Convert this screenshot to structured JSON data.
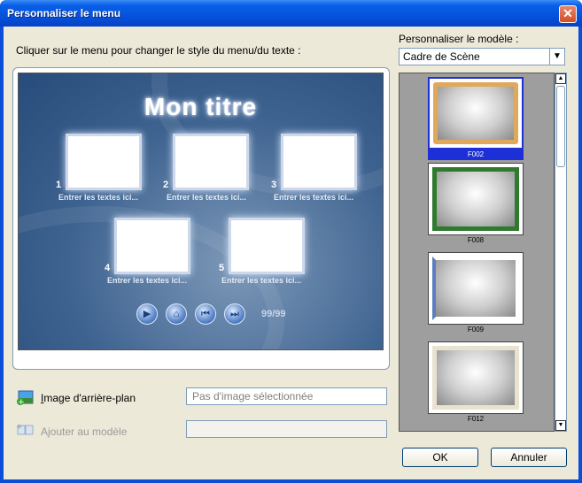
{
  "window": {
    "title": "Personnaliser le menu",
    "close_glyph": "✕"
  },
  "instructions": "Cliquer sur le menu pour changer le style du menu/du texte :",
  "preview": {
    "menu_title": "Mon titre",
    "items": [
      {
        "num": "1",
        "caption": "Entrer les textes ici..."
      },
      {
        "num": "2",
        "caption": "Entrer les textes ici..."
      },
      {
        "num": "3",
        "caption": "Entrer les textes ici..."
      },
      {
        "num": "4",
        "caption": "Entrer les textes ici..."
      },
      {
        "num": "5",
        "caption": "Entrer les textes ici..."
      }
    ],
    "nav_icons": [
      "play-icon",
      "home-icon",
      "previous-icon",
      "next-icon"
    ],
    "page_count": "99/99"
  },
  "background": {
    "mnemonic": "I",
    "label_rest": "mage d'arrière-plan",
    "placeholder": "Pas d'image sélectionnée"
  },
  "add_to_template": {
    "label": "Ajouter au modèle"
  },
  "template": {
    "label": "Personnaliser le modèle :",
    "selected": "Cadre de Scène",
    "items": [
      {
        "id": "F002",
        "selected": true
      },
      {
        "id": "F008",
        "selected": false
      },
      {
        "id": "F009",
        "selected": false
      },
      {
        "id": "F012",
        "selected": false
      }
    ]
  },
  "buttons": {
    "ok": "OK",
    "cancel": "Annuler"
  },
  "colors": {
    "titlebar": "#0553dd",
    "selection": "#1d2fd6",
    "client": "#ece9d8",
    "preview_bg": "#3e6390"
  }
}
